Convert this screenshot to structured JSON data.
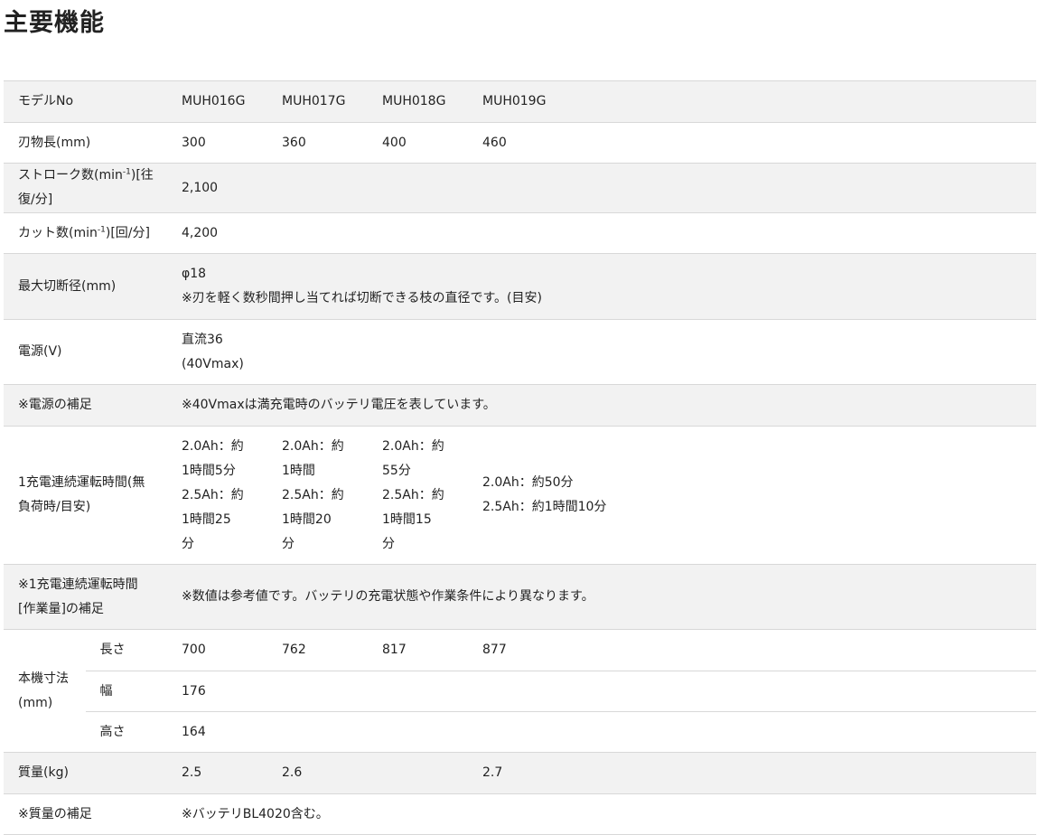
{
  "page_title": "主要機能",
  "model_row": {
    "label": "モデルNo",
    "models": [
      "MUH016G",
      "MUH017G",
      "MUH018G",
      "MUH019G"
    ]
  },
  "blade_length": {
    "label": "刃物長(mm)",
    "values": [
      "300",
      "360",
      "400",
      "460"
    ]
  },
  "stroke": {
    "label_pre": "ストローク数(min",
    "label_sup": "-1",
    "label_post": ")[往復/分]",
    "value": "2,100"
  },
  "cut": {
    "label_pre": "カット数(min",
    "label_sup": "-1",
    "label_post": ")[回/分]",
    "value": "4,200"
  },
  "max_cut": {
    "label": "最大切断径(mm)",
    "value": "φ18",
    "note": "※刃を軽く数秒間押し当てれば切断できる枝の直径です。(目安)"
  },
  "power": {
    "label": "電源(V)",
    "line1": "直流36",
    "line2": "(40Vmax)"
  },
  "power_note": {
    "label": "※電源の補足",
    "value": "※40Vmaxは満充電時のバッテリ電圧を表しています。"
  },
  "runtime": {
    "label": "1充電連続運転時間(無負荷時/目安)",
    "values": [
      [
        "2.0Ah：約",
        "1時間5分",
        "2.5Ah：約",
        "1時間25",
        "分"
      ],
      [
        "2.0Ah：約",
        "1時間",
        "2.5Ah：約",
        "1時間20",
        "分"
      ],
      [
        "2.0Ah：約",
        "55分",
        "2.5Ah：約",
        "1時間15",
        "分"
      ],
      [
        "2.0Ah：約50分",
        "2.5Ah：約1時間10分"
      ]
    ]
  },
  "runtime_note": {
    "label": "※1充電連続運転時間[作業量]の補足",
    "value": "※数値は参考値です。バッテリの充電状態や作業条件により異なります。"
  },
  "dimensions": {
    "label": "本機寸法(mm)",
    "length_label": "長さ",
    "length_values": [
      "700",
      "762",
      "817",
      "877"
    ],
    "width_label": "幅",
    "width_value": "176",
    "height_label": "高さ",
    "height_value": "164"
  },
  "weight": {
    "label": "質量(kg)",
    "values": [
      "2.5",
      "2.6",
      "2.7"
    ]
  },
  "weight_note": {
    "label": "※質量の補足",
    "value": "※バッテリBL4020含む。"
  }
}
